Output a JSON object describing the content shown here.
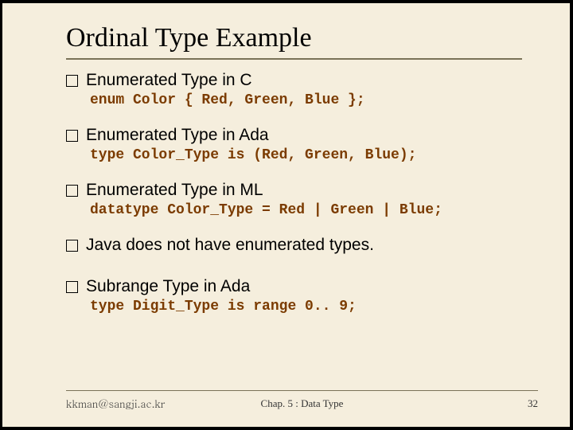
{
  "title": "Ordinal Type Example",
  "items": [
    {
      "heading": "Enumerated Type in C",
      "code": "enum Color { Red, Green, Blue };"
    },
    {
      "heading": "Enumerated Type in Ada",
      "code": "type Color_Type is (Red, Green, Blue);"
    },
    {
      "heading": "Enumerated Type in ML",
      "code": "datatype Color_Type = Red | Green | Blue;"
    },
    {
      "heading": "Java does not have enumerated types.",
      "code": ""
    },
    {
      "heading": "Subrange Type in Ada",
      "code": "type Digit_Type is range 0.. 9;"
    }
  ],
  "footer": {
    "left": "kkman@sangji.ac.kr",
    "center": "Chap. 5 : Data Type",
    "right": "32"
  }
}
